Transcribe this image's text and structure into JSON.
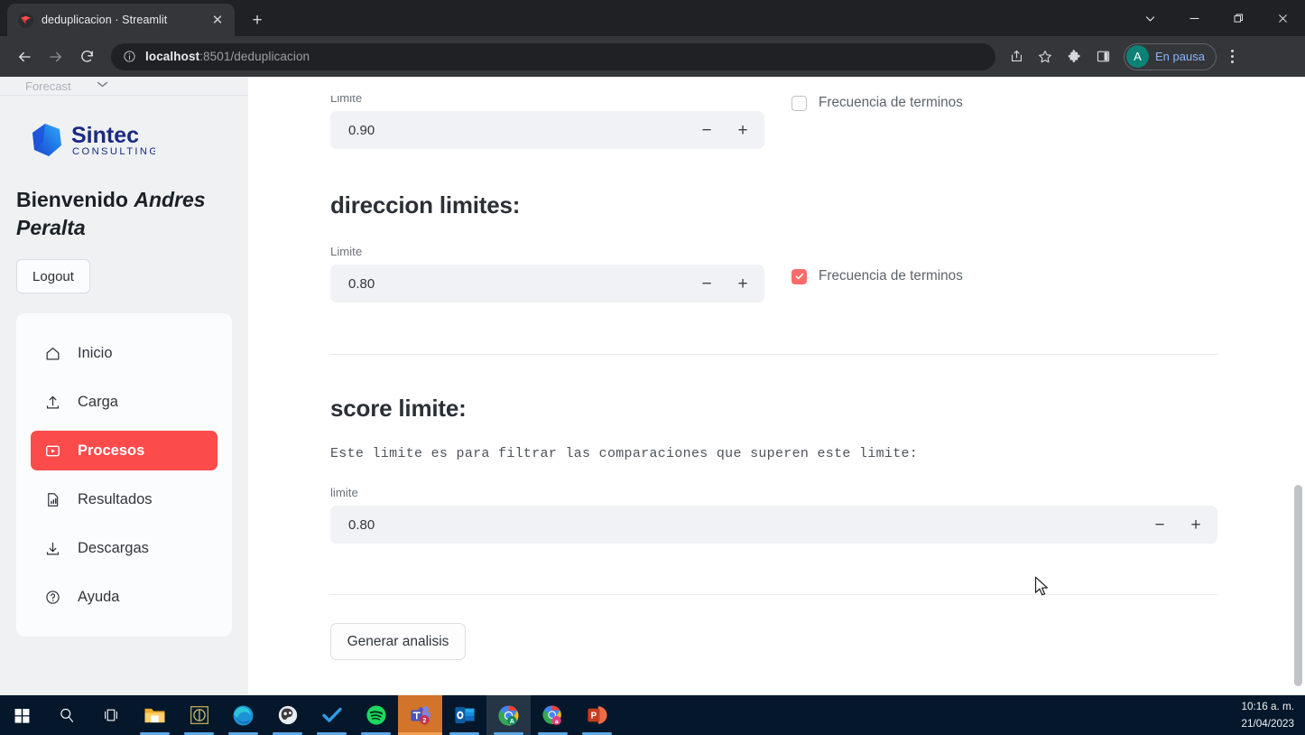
{
  "browser": {
    "tab": {
      "title": "deduplicacion · Streamlit",
      "favicon_name": "streamlit-favicon",
      "close_label": "✕"
    },
    "new_tab_label": "+",
    "window_controls": {
      "minimize": "—",
      "maximize": "❐",
      "close": "✕",
      "tab_search": "⌄"
    },
    "nav": {
      "back": "←",
      "forward": "→",
      "reload": "⟳"
    },
    "omnibox": {
      "info_icon": "site-info-icon",
      "url_host": "localhost",
      "url_rest": ":8501/deduplicacion",
      "full_url": "localhost:8501/deduplicacion"
    },
    "toolbar_icons": [
      "share-icon",
      "bookmark-star-icon",
      "extensions-puzzle-icon",
      "side-panel-icon"
    ],
    "profile": {
      "initial": "A",
      "status_text": "En pausa"
    },
    "menu_icon": "kebab-menu-icon"
  },
  "app": {
    "top_strip": {
      "label": "Forecast",
      "caret": "⌄"
    },
    "sidebar": {
      "logo": {
        "name": "Sintec",
        "tagline": "CONSULTING"
      },
      "welcome_prefix": "Bienvenido",
      "user_name": "Andres Peralta",
      "logout_label": "Logout",
      "nav_items": [
        {
          "label": "Inicio",
          "icon": "home-icon",
          "active": false
        },
        {
          "label": "Carga",
          "icon": "upload-icon",
          "active": false
        },
        {
          "label": "Procesos",
          "icon": "play-box-icon",
          "active": true
        },
        {
          "label": "Resultados",
          "icon": "bar-chart-doc-icon",
          "active": false
        },
        {
          "label": "Descargas",
          "icon": "download-icon",
          "active": false
        },
        {
          "label": "Ayuda",
          "icon": "question-circle-icon",
          "active": false
        }
      ]
    },
    "main": {
      "block_1": {
        "field_label": "Limite",
        "value": "0.90",
        "minus": "−",
        "plus": "+",
        "checkbox_label": "Frecuencia de terminos",
        "checked": false
      },
      "block_2": {
        "title": "direccion limites:",
        "field_label": "Limite",
        "value": "0.80",
        "minus": "−",
        "plus": "+",
        "checkbox_label": "Frecuencia de terminos",
        "checked": true
      },
      "block_3": {
        "title": "score limite:",
        "description": "Este limite es para filtrar las comparaciones que superen este limite:",
        "field_label": "limite",
        "value": "0.80",
        "minus": "−",
        "plus": "+"
      },
      "generate_button": "Generar analisis"
    }
  },
  "taskbar": {
    "items": [
      {
        "name": "start-button",
        "icon": "windows-logo-icon",
        "open": false,
        "hot": false
      },
      {
        "name": "search-button",
        "icon": "search-icon",
        "open": false,
        "hot": false
      },
      {
        "name": "task-view-button",
        "icon": "task-view-icon",
        "open": false,
        "hot": false
      },
      {
        "name": "file-explorer",
        "icon": "folder-icon",
        "open": true,
        "hot": false
      },
      {
        "name": "app-pinned",
        "icon": "copyright-box-icon",
        "open": true,
        "hot": false
      },
      {
        "name": "microsoft-edge",
        "icon": "edge-icon",
        "open": true,
        "hot": false
      },
      {
        "name": "browser-app",
        "icon": "globe-icon",
        "open": true,
        "hot": false
      },
      {
        "name": "todo-app",
        "icon": "checkmark-icon",
        "open": true,
        "hot": false
      },
      {
        "name": "spotify",
        "icon": "spotify-icon",
        "open": true,
        "hot": false
      },
      {
        "name": "microsoft-teams",
        "icon": "teams-icon",
        "badge": "2",
        "open": true,
        "hot": true
      },
      {
        "name": "microsoft-outlook",
        "icon": "outlook-icon",
        "open": true,
        "hot": false
      },
      {
        "name": "google-chrome",
        "icon": "chrome-icon",
        "open": true,
        "hot": false,
        "hovered": true
      },
      {
        "name": "google-chrome-2",
        "icon": "chrome-profile-icon",
        "open": true,
        "hot": false
      },
      {
        "name": "powerpoint",
        "icon": "powerpoint-icon",
        "open": true,
        "hot": false
      }
    ],
    "clock": {
      "time": "10:16 a. m.",
      "date": "21/04/2023"
    }
  },
  "colors": {
    "accent_red": "#fc4b4b",
    "checkbox_red": "#fc6a6a",
    "sidebar_bg": "#eff1f3",
    "input_bg": "#f0f2f6",
    "chrome_dark": "#35363a",
    "tabstrip_dark": "#202124",
    "taskbar": "#05182b",
    "profile_blue": "#8ab4f8"
  }
}
